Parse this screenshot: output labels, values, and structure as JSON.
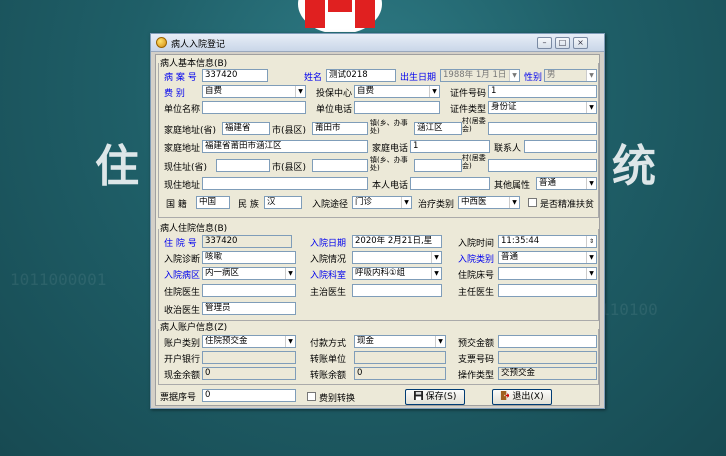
{
  "background": {
    "left_text": "住",
    "right_text": "统"
  },
  "window": {
    "title": "病人入院登记",
    "min": "–",
    "max": "□",
    "close": "×"
  },
  "basic": {
    "group_title": "病人基本信息(B)",
    "case_no_label": "病 案 号",
    "case_no": "337420",
    "name_label": "姓名",
    "name": "测试0218",
    "birth_label": "出生日期",
    "birth": "1988年 1月 1日",
    "sex_label": "性别",
    "sex": "男",
    "fee_label": "费    别",
    "fee": "自费",
    "insure_label": "投保中心",
    "insure": "自费",
    "id_no_label": "证件号码",
    "id_no": "1",
    "work_label": "单位名称",
    "work": "",
    "work_phone_label": "单位电话",
    "work_phone": "",
    "id_type_label": "证件类型",
    "id_type": "身份证",
    "home_prov_label": "家庭地址(省)",
    "home_prov": "福建省",
    "home_city_label": "市(县区)",
    "home_city": "莆田市",
    "home_town_label": "镇(乡、办事处)",
    "home_town": "涵江区",
    "home_village_label": "村(居委会)",
    "home_village": "",
    "home_addr_label": "家庭地址",
    "home_addr": "福建省莆田市涵江区",
    "home_phone_label": "家庭电话",
    "home_phone": "1",
    "contact_label": "联系人",
    "contact": "",
    "cur_prov_label": "现住址(省)",
    "cur_prov": "",
    "cur_city_label": "市(县区)",
    "cur_city": "",
    "cur_town_label": "镇(乡、办事处)",
    "cur_town": "",
    "cur_village_label": "村(居委会)",
    "cur_village": "",
    "cur_addr_label": "现住地址",
    "cur_addr": "",
    "self_phone_label": "本人电话",
    "self_phone": "",
    "other_label": "其他属性",
    "other": "普通",
    "nation_label": "国  籍",
    "nation": "中国",
    "ethnic_label": "民  族",
    "ethnic": "汉",
    "admit_way_label": "入院途径",
    "admit_way": "门诊",
    "treat_label": "治疗类别",
    "treat": "中西医",
    "poverty_label": "是否精准扶贫"
  },
  "inpatient": {
    "group_title": "病人住院信息(B)",
    "hosp_no_label": "住 院 号",
    "hosp_no": "337420",
    "admit_date_label": "入院日期",
    "admit_date": "2020年 2月21日,星",
    "admit_time_label": "入院时间",
    "admit_time": "11:35:44",
    "diag_label": "入院诊断",
    "diag": "咳嗽",
    "cond_label": "入院情况",
    "cond": "",
    "cat_label": "入院类别",
    "cat": "普通",
    "ward_label": "入院病区",
    "ward": "内一病区",
    "dept_label": "入院科室",
    "dept": "呼吸内科①组",
    "bed_label": "住院床号",
    "bed": "",
    "doctor_label": "住院医生",
    "doctor": "",
    "attend_label": "主治医生",
    "attend": "",
    "chief_label": "主任医生",
    "chief": "",
    "admit_doc_label": "收治医生",
    "admit_doc": "管理员"
  },
  "account": {
    "group_title": "病人账户信息(Z)",
    "acct_type_label": "账户类别",
    "acct_type": "住院预交金",
    "pay_label": "付款方式",
    "pay": "现金",
    "prepay_label": "预交金额",
    "prepay": "",
    "bank_label": "开户银行",
    "bank": "",
    "transfer_unit_label": "转账单位",
    "transfer_unit": "",
    "check_label": "支票号码",
    "check": "",
    "cash_bal_label": "现金余额",
    "cash_bal": "0",
    "transfer_bal_label": "转账余额",
    "transfer_bal": "0",
    "op_type_label": "操作类型",
    "op_type": "交预交金"
  },
  "footer": {
    "receipt_label": "票据序号",
    "receipt": "0",
    "fee_convert_label": "费别转换",
    "save": "保存(S)",
    "exit": "退出(X)"
  }
}
